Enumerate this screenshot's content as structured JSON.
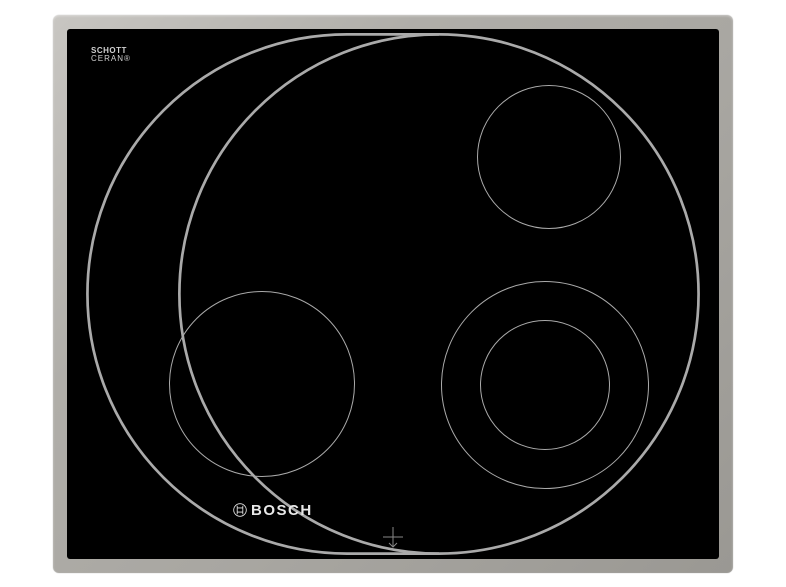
{
  "product": {
    "type": "ceramic-cooktop",
    "frame_material": "stainless-steel"
  },
  "labels": {
    "schott_line1": "SCHOTT",
    "schott_line2": "CERAN®",
    "schott_line3": "",
    "brand_name": "BOSCH"
  },
  "colors": {
    "surface": "#000000",
    "frame": "#b0aea9",
    "outline": "#aaaaaa",
    "text": "#e8e8e8"
  },
  "zones": {
    "top_left": {
      "type": "extendable-oval",
      "description": "dual zone with extension"
    },
    "top_right": {
      "type": "single-circle",
      "description": "small zone"
    },
    "bottom_left": {
      "type": "single-circle",
      "description": "large zone"
    },
    "bottom_right": {
      "type": "dual-circle",
      "description": "dual concentric zone"
    }
  }
}
